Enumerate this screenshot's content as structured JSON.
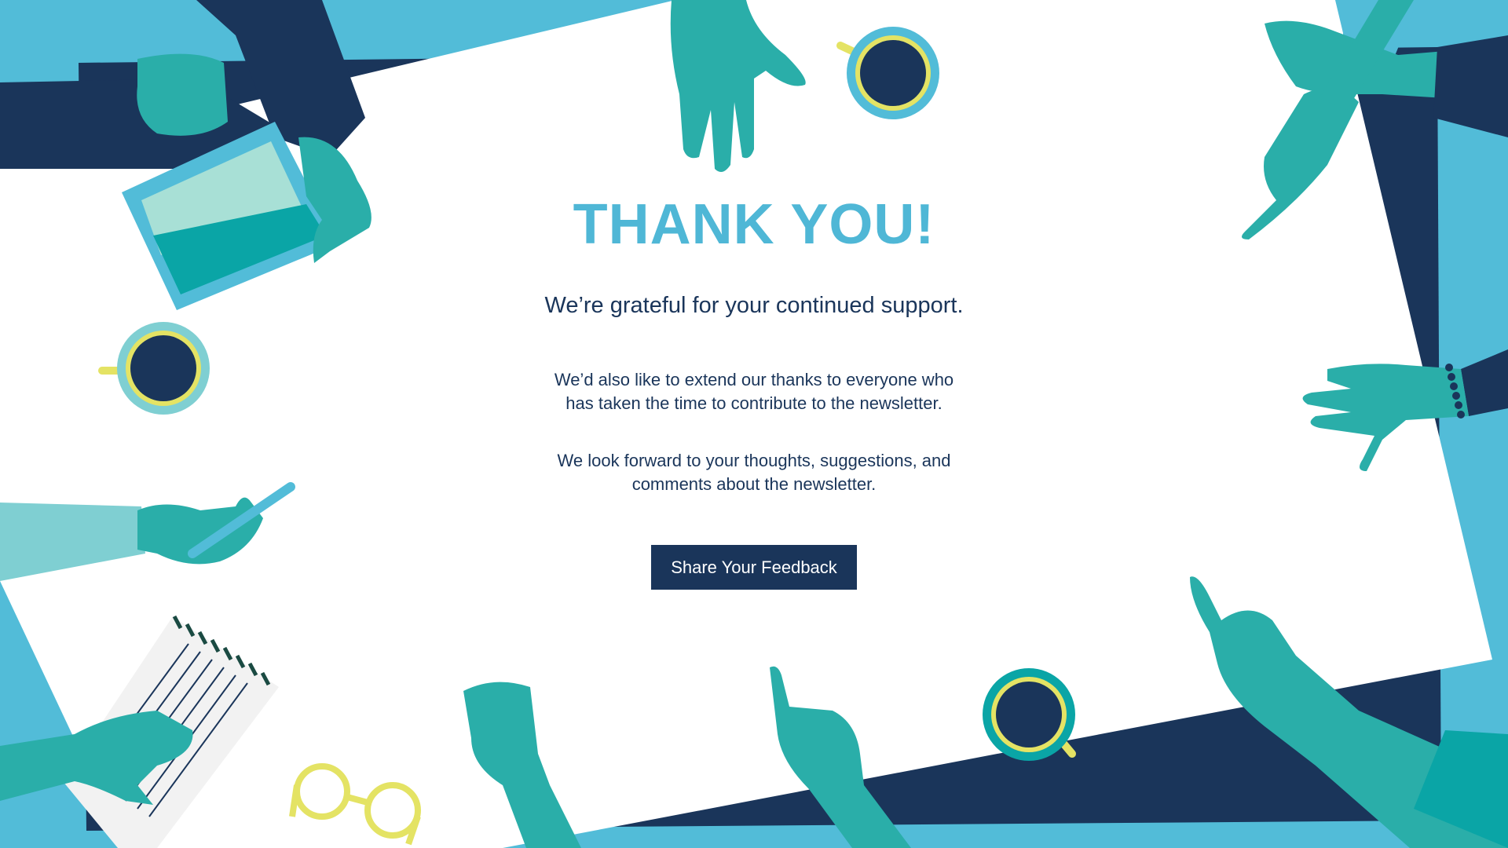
{
  "page": {
    "title": "THANK YOU!",
    "subtitle": "We’re grateful for your continued support.",
    "paragraph_1": "We’d also like to extend our thanks to everyone who has taken the time to contribute to the newsletter.",
    "paragraph_2": "We look forward to your thoughts, suggestions, and comments about the newsletter.",
    "cta_label": "Share Your Feedback"
  },
  "colors": {
    "background": "#52bcd8",
    "navy": "#1a355a",
    "teal": "#2aaea9",
    "title": "#4fb7d6",
    "yellow": "#e4e364",
    "white": "#ffffff"
  },
  "illustrations": [
    "hand-icon",
    "coffee-cup-icon",
    "tablet-icon",
    "pen-icon",
    "notepad-icon",
    "glasses-icon",
    "thumbs-up-icon",
    "thumbs-down-icon",
    "pointing-hand-icon"
  ]
}
